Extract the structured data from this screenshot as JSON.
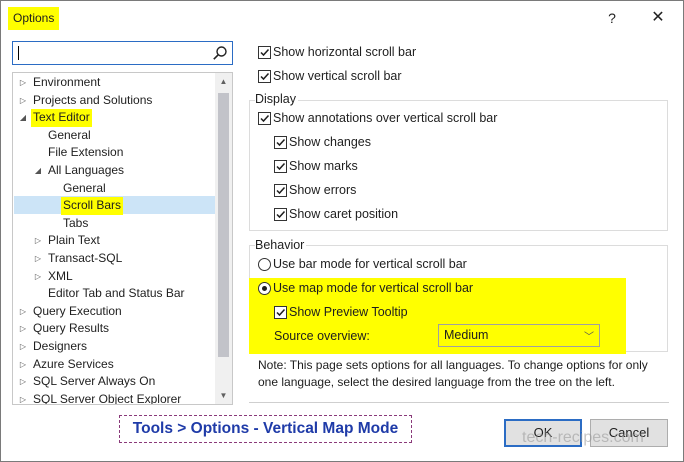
{
  "window": {
    "title": "Options",
    "help_glyph": "?",
    "close_glyph": "✕"
  },
  "search": {
    "value": "",
    "icon": "search-icon"
  },
  "tree": {
    "items": [
      {
        "label": "Environment",
        "arrow": "▷"
      },
      {
        "label": "Projects and Solutions",
        "arrow": "▷"
      },
      {
        "label": "Text Editor",
        "arrow": "◢"
      },
      {
        "label": "General",
        "arrow": ""
      },
      {
        "label": "File Extension",
        "arrow": ""
      },
      {
        "label": "All Languages",
        "arrow": "◢"
      },
      {
        "label": "General",
        "arrow": ""
      },
      {
        "label": "Scroll Bars",
        "arrow": ""
      },
      {
        "label": "Tabs",
        "arrow": ""
      },
      {
        "label": "Plain Text",
        "arrow": "▷"
      },
      {
        "label": "Transact-SQL",
        "arrow": "▷"
      },
      {
        "label": "XML",
        "arrow": "▷"
      },
      {
        "label": "Editor Tab and Status Bar",
        "arrow": ""
      },
      {
        "label": "Query Execution",
        "arrow": "▷"
      },
      {
        "label": "Query Results",
        "arrow": "▷"
      },
      {
        "label": "Designers",
        "arrow": "▷"
      },
      {
        "label": "Azure Services",
        "arrow": "▷"
      },
      {
        "label": "SQL Server Always On",
        "arrow": "▷"
      },
      {
        "label": "SQL Server Object Explorer",
        "arrow": "▷"
      }
    ],
    "selected": "Scroll Bars"
  },
  "options": {
    "show_horizontal": {
      "label": "Show horizontal scroll bar",
      "checked": true
    },
    "show_vertical": {
      "label": "Show vertical scroll bar",
      "checked": true
    },
    "display": {
      "title": "Display",
      "show_annotations": {
        "label": "Show annotations over vertical scroll bar",
        "checked": true
      },
      "show_changes": {
        "label": "Show changes",
        "checked": true
      },
      "show_marks": {
        "label": "Show marks",
        "checked": true
      },
      "show_errors": {
        "label": "Show errors",
        "checked": true
      },
      "show_caret": {
        "label": "Show caret position",
        "checked": true
      }
    },
    "behavior": {
      "title": "Behavior",
      "bar_mode": {
        "label": "Use bar mode for vertical scroll bar",
        "selected": false
      },
      "map_mode": {
        "label": "Use map mode for vertical scroll bar",
        "selected": true
      },
      "preview_tooltip": {
        "label": "Show Preview Tooltip",
        "checked": true
      },
      "source_overview_label": "Source overview:",
      "source_overview_value": "Medium"
    },
    "note": "Note: This page sets options for all languages. To change options for only one language, select the desired language from the tree on the left."
  },
  "caption": "Tools > Options - Vertical Map Mode",
  "buttons": {
    "ok": "OK",
    "cancel": "Cancel"
  },
  "watermark": "tech-recipes.com",
  "colors": {
    "highlight": "#ffff00",
    "caption_text": "#1f3ba8",
    "accent": "#2b6cc4"
  }
}
